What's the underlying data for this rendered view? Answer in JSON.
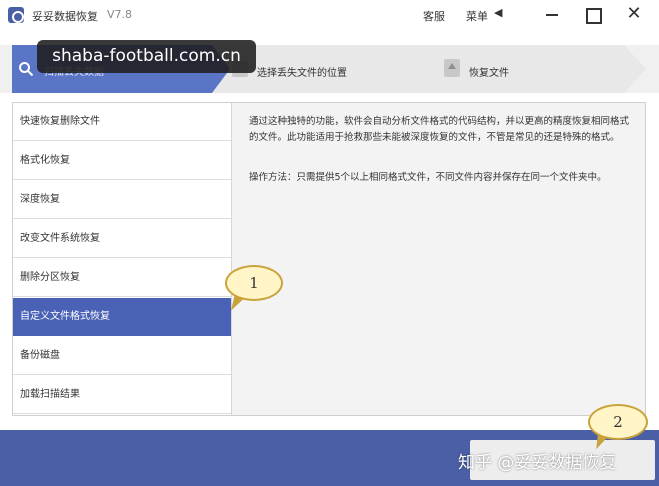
{
  "titlebar": {
    "app_name": "妥妥数据恢复",
    "version": "V7.8",
    "service_label": "客服",
    "menu_label": "菜单",
    "menu_arrow": "◀",
    "close_glyph": "✕"
  },
  "steps": {
    "step1_label": "扫描丢失数据",
    "step2_label": "选择丢失文件的位置",
    "step3_label": "恢复文件"
  },
  "watermark": {
    "url": "shaba-football.com.cn",
    "zhihu": "知乎 @妥妥数据恢复"
  },
  "sidebar": {
    "items": [
      {
        "label": "快速恢复删除文件"
      },
      {
        "label": "格式化恢复"
      },
      {
        "label": "深度恢复"
      },
      {
        "label": "改变文件系统恢复"
      },
      {
        "label": "删除分区恢复"
      },
      {
        "label": "自定义文件格式恢复",
        "selected": true
      },
      {
        "label": "备份磁盘"
      },
      {
        "label": "加载扫描结果"
      }
    ]
  },
  "detail": {
    "description": "通过这种独特的功能，软件会自动分析文件格式的代码结构，并以更高的精度恢复相同格式的文件。此功能适用于抢救那些未能被深度恢复的文件，不管是常见的还是特殊的格式。",
    "method": "操作方法：只需提供5个以上相同格式文件，不同文件内容并保存在同一个文件夹中。"
  },
  "callouts": {
    "one": "1",
    "two": "2"
  },
  "colors": {
    "accent": "#4a62b5",
    "bottom_bar": "#4a5fa5",
    "callout_fill": "#fff5c7",
    "callout_border": "#c9a23a"
  }
}
